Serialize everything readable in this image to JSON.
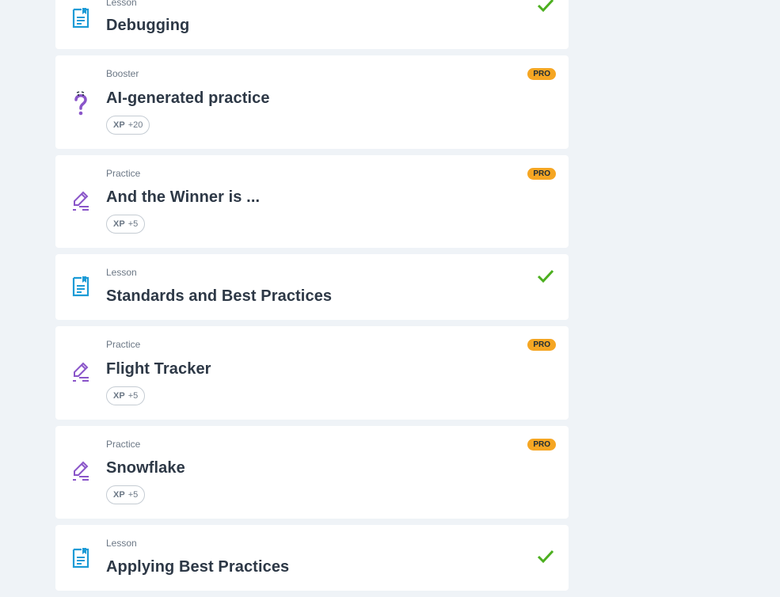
{
  "colors": {
    "background": "#eff3f7",
    "lesson_icon": "#1c9bd6",
    "practice_icon": "#8a55c9",
    "booster_icon": "#8a55c9",
    "check": "#4caf1f",
    "pro_badge": "#f5a623"
  },
  "items": [
    {
      "type": "Lesson",
      "title": "Debugging",
      "icon": "lesson-document-icon",
      "status": "completed"
    },
    {
      "type": "Booster",
      "title": "AI-generated practice",
      "icon": "question-mark-icon",
      "badge": "PRO",
      "xp_label": "XP",
      "xp_value": "+20"
    },
    {
      "type": "Practice",
      "title": "And the Winner is ...",
      "icon": "pencil-icon",
      "badge": "PRO",
      "xp_label": "XP",
      "xp_value": "+5"
    },
    {
      "type": "Lesson",
      "title": "Standards and Best Practices",
      "icon": "lesson-document-icon",
      "status": "completed"
    },
    {
      "type": "Practice",
      "title": "Flight Tracker",
      "icon": "pencil-icon",
      "badge": "PRO",
      "xp_label": "XP",
      "xp_value": "+5"
    },
    {
      "type": "Practice",
      "title": "Snowflake",
      "icon": "pencil-icon",
      "badge": "PRO",
      "xp_label": "XP",
      "xp_value": "+5"
    },
    {
      "type": "Lesson",
      "title": "Applying Best Practices",
      "icon": "lesson-document-icon",
      "status": "completed"
    }
  ]
}
